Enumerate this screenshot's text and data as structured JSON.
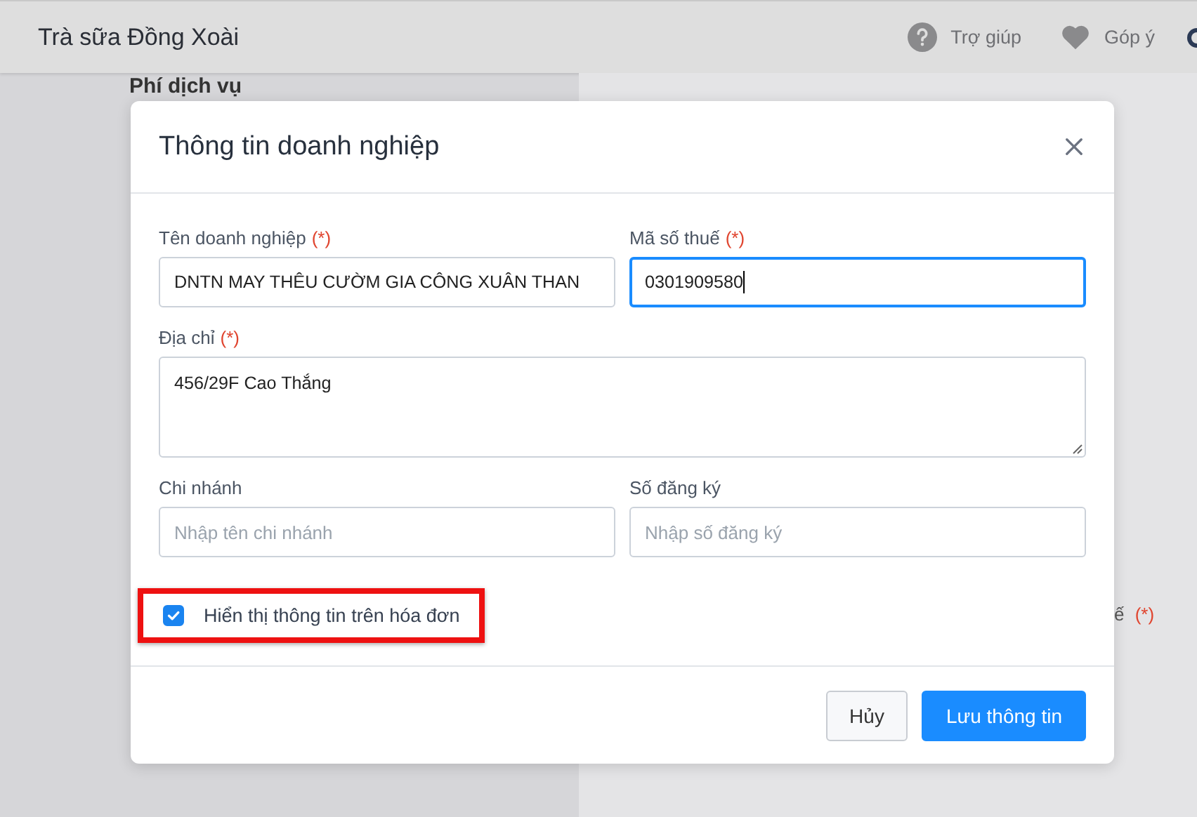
{
  "app": {
    "title": "Trà sữa Đồng Xoài",
    "links": [
      {
        "label": "Trợ giúp",
        "kind": "help"
      },
      {
        "label": "Góp ý",
        "kind": "feedback"
      }
    ]
  },
  "background": {
    "section_title": "Phí dịch vụ",
    "label_fragment": "ế",
    "required_mark": "(*)"
  },
  "dialog": {
    "title": "Thông tin doanh nghiệp",
    "fields": [
      {
        "kind": "input",
        "label": "Tên doanh nghiệp",
        "required_mark": "(*)",
        "value": "DNTN MAY THÊU CƯỜM GIA CÔNG XUÂN THAN",
        "focused": false
      },
      {
        "kind": "input",
        "label": "Mã số thuế",
        "required_mark": "(*)",
        "value": "0301909580",
        "focused": true
      },
      {
        "kind": "textarea",
        "label": "Địa chỉ",
        "required_mark": "(*)",
        "value": "456/29F Cao Thắng",
        "focused": false
      },
      {
        "kind": "input",
        "label": "Chi nhánh",
        "placeholder": "Nhập tên chi nhánh",
        "focused": false
      },
      {
        "kind": "input",
        "label": "Số đăng ký",
        "placeholder": "Nhập số đăng ký",
        "focused": false
      }
    ],
    "checkbox": {
      "label": "Hiển thị thông tin trên hóa đơn",
      "checked": true,
      "highlighted": true
    },
    "buttons": [
      {
        "label": "Hủy",
        "kind": "secondary"
      },
      {
        "label": "Lưu thông tin",
        "kind": "primary"
      }
    ]
  }
}
